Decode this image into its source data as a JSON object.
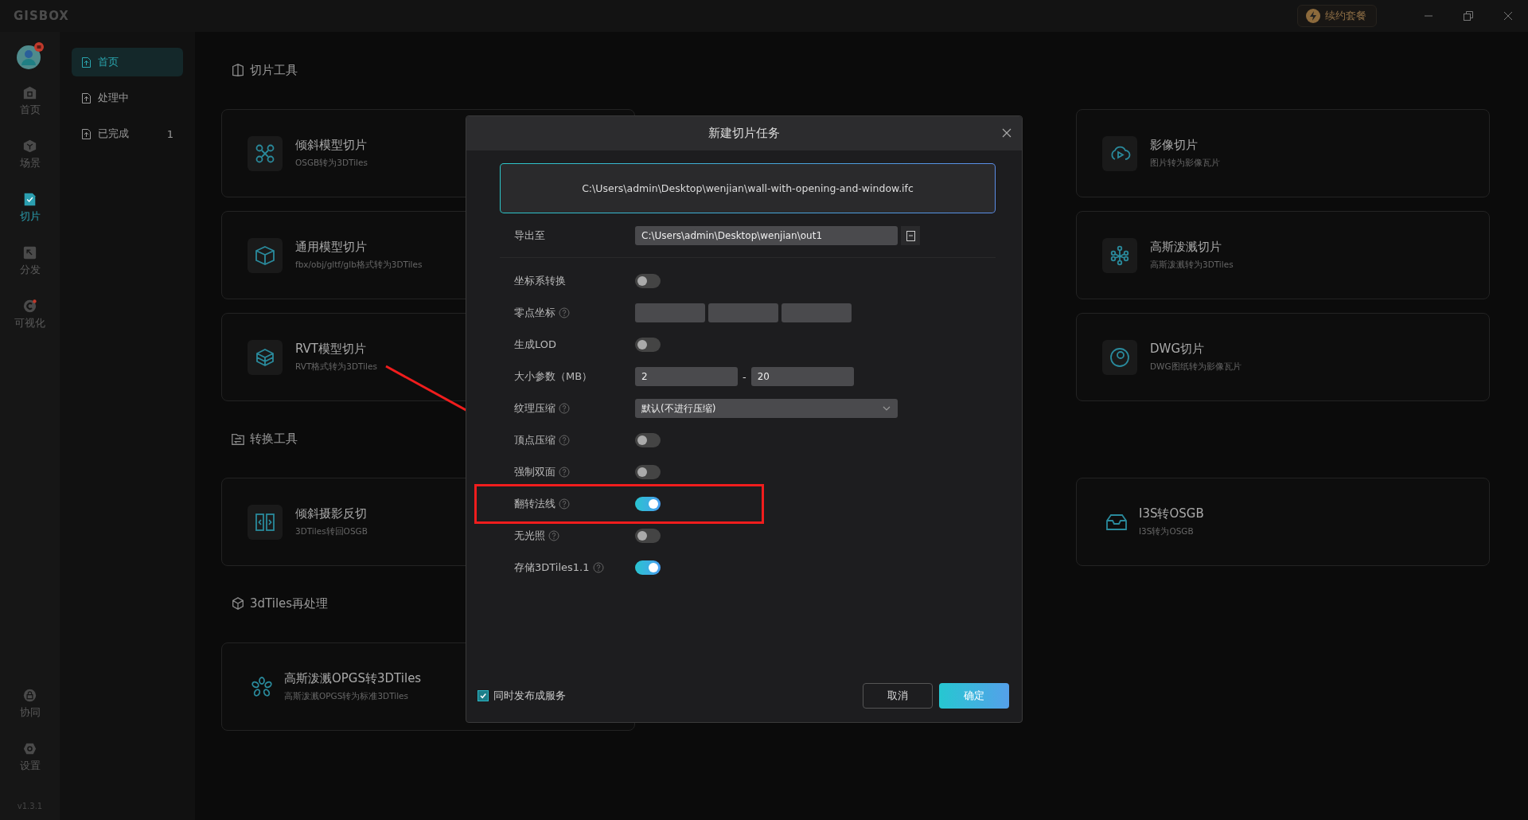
{
  "titlebar": {
    "logo": "GISBOX",
    "promo_button": "续约套餐"
  },
  "rail": {
    "items": [
      {
        "label": "首页",
        "kind": "home",
        "selected": false
      },
      {
        "label": "场景",
        "kind": "scene",
        "selected": false
      },
      {
        "label": "切片",
        "kind": "tiles",
        "selected": true
      },
      {
        "label": "分发",
        "kind": "share",
        "selected": false
      },
      {
        "label": "可视化",
        "kind": "visual",
        "selected": false
      }
    ],
    "bottom": [
      {
        "label": "协同",
        "kind": "lock"
      },
      {
        "label": "设置",
        "kind": "settings"
      }
    ],
    "version": "v1.3.1"
  },
  "nav": [
    {
      "label": "首页",
      "selected": true
    },
    {
      "label": "处理中",
      "selected": false
    },
    {
      "label": "已完成",
      "selected": false,
      "count": "1"
    }
  ],
  "sections": [
    {
      "title": "切片工具",
      "kind": "slice",
      "rows": [
        [
          {
            "title": "倾斜模型切片",
            "subtitle": "OSGB转为3DTiles",
            "kind": "drone"
          },
          null,
          {
            "title": "影像切片",
            "subtitle": "图片转为影像瓦片",
            "kind": "cloud"
          }
        ],
        [
          {
            "title": "通用模型切片",
            "subtitle": "fbx/obj/gltf/glb格式转为3DTiles",
            "kind": "box"
          },
          null,
          {
            "title": "高斯泼溅切片",
            "subtitle": "高斯泼溅转为3DTiles",
            "kind": "nodes"
          }
        ],
        [
          {
            "title": "RVT模型切片",
            "subtitle": "RVT格式转为3DTiles",
            "kind": "cube"
          },
          null,
          {
            "title": "DWG切片",
            "subtitle": "DWG图纸转为影像瓦片",
            "kind": "ring"
          }
        ]
      ]
    },
    {
      "title": "转换工具",
      "kind": "convert",
      "rows": [
        [
          {
            "title": "倾斜摄影反切",
            "subtitle": "3DTiles转回OSGB",
            "kind": "split"
          },
          null,
          {
            "title": "I3S转OSGB",
            "subtitle": "I3S转为OSGB",
            "kind": "tray"
          }
        ]
      ]
    },
    {
      "title": "3dTiles再处理",
      "kind": "reprocess",
      "rows": [
        [
          {
            "title": "高斯泼溅OPGS转3DTiles",
            "subtitle": "高斯泼溅OPGS转为标准3DTiles",
            "kind": "flower"
          }
        ]
      ]
    }
  ],
  "dialog": {
    "title": "新建切片任务",
    "file_path": "C:\\Users\\admin\\Desktop\\wenjian\\wall-with-opening-and-window.ifc",
    "export": {
      "label": "导出至",
      "value": "C:\\Users\\admin\\Desktop\\wenjian\\out1"
    },
    "options": [
      {
        "kind": "toggle",
        "label": "坐标系转换",
        "help": false,
        "on": false,
        "highlighted": false
      },
      {
        "kind": "coords",
        "label": "零点坐标",
        "help": true
      },
      {
        "kind": "toggle",
        "label": "生成LOD",
        "help": false,
        "on": false,
        "highlighted": false
      },
      {
        "kind": "range",
        "label": "大小参数（MB）",
        "help": false,
        "min": "2",
        "separator": "-",
        "max": "20"
      },
      {
        "kind": "select",
        "label": "纹理压缩",
        "help": true,
        "value": "默认(不进行压缩)"
      },
      {
        "kind": "toggle",
        "label": "顶点压缩",
        "help": true,
        "on": false,
        "highlighted": false
      },
      {
        "kind": "toggle",
        "label": "强制双面",
        "help": true,
        "on": false,
        "highlighted": false
      },
      {
        "kind": "toggle",
        "label": "翻转法线",
        "help": true,
        "on": true,
        "highlighted": true
      },
      {
        "kind": "toggle",
        "label": "无光照",
        "help": true,
        "on": false,
        "highlighted": false
      },
      {
        "kind": "toggle",
        "label": "存储3DTiles1.1",
        "help": true,
        "on": true,
        "highlighted": false
      }
    ],
    "publish": {
      "label": "同时发布成服务",
      "checked": true
    },
    "buttons": [
      {
        "label": "取消",
        "kind": "secondary"
      },
      {
        "label": "确定",
        "kind": "primary"
      }
    ]
  }
}
